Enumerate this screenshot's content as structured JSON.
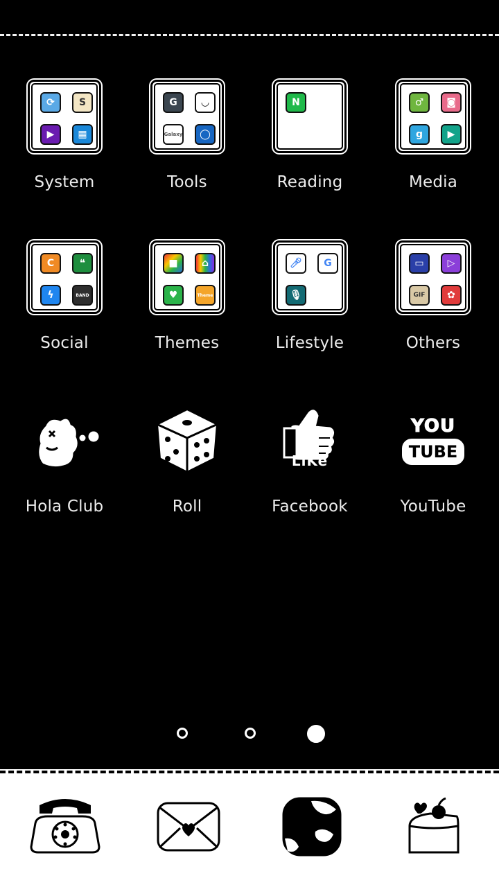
{
  "home": {
    "page_indicator": {
      "pages": 3,
      "active_page": 3
    },
    "apps": [
      {
        "label": "System",
        "icon": "folder-system-icon"
      },
      {
        "label": "Tools",
        "icon": "folder-tools-icon"
      },
      {
        "label": "Reading",
        "icon": "folder-reading-icon"
      },
      {
        "label": "Media",
        "icon": "folder-media-icon"
      },
      {
        "label": "Social",
        "icon": "folder-social-icon"
      },
      {
        "label": "Themes",
        "icon": "folder-themes-icon"
      },
      {
        "label": "Lifestyle",
        "icon": "folder-lifestyle-icon"
      },
      {
        "label": "Others",
        "icon": "folder-others-icon"
      },
      {
        "label": "Hola Club",
        "icon": "dino-icon"
      },
      {
        "label": "Roll",
        "icon": "dice-icon"
      },
      {
        "label": "Facebook",
        "icon": "thumbs-up-like-icon"
      },
      {
        "label": "YouTube",
        "icon": "youtube-text-icon"
      }
    ],
    "icon_text": {
      "samsung": "S",
      "naver": "N",
      "band": "BAND",
      "galaxy": "Galaxy",
      "theme": "Theme",
      "gif": "GIF",
      "like": "LiKe",
      "you": "YOU",
      "tube": "TUBE"
    }
  },
  "dock": [
    {
      "icon": "rotary-phone-icon"
    },
    {
      "icon": "envelope-heart-icon"
    },
    {
      "icon": "cow-pattern-icon"
    },
    {
      "icon": "cake-icon"
    }
  ]
}
